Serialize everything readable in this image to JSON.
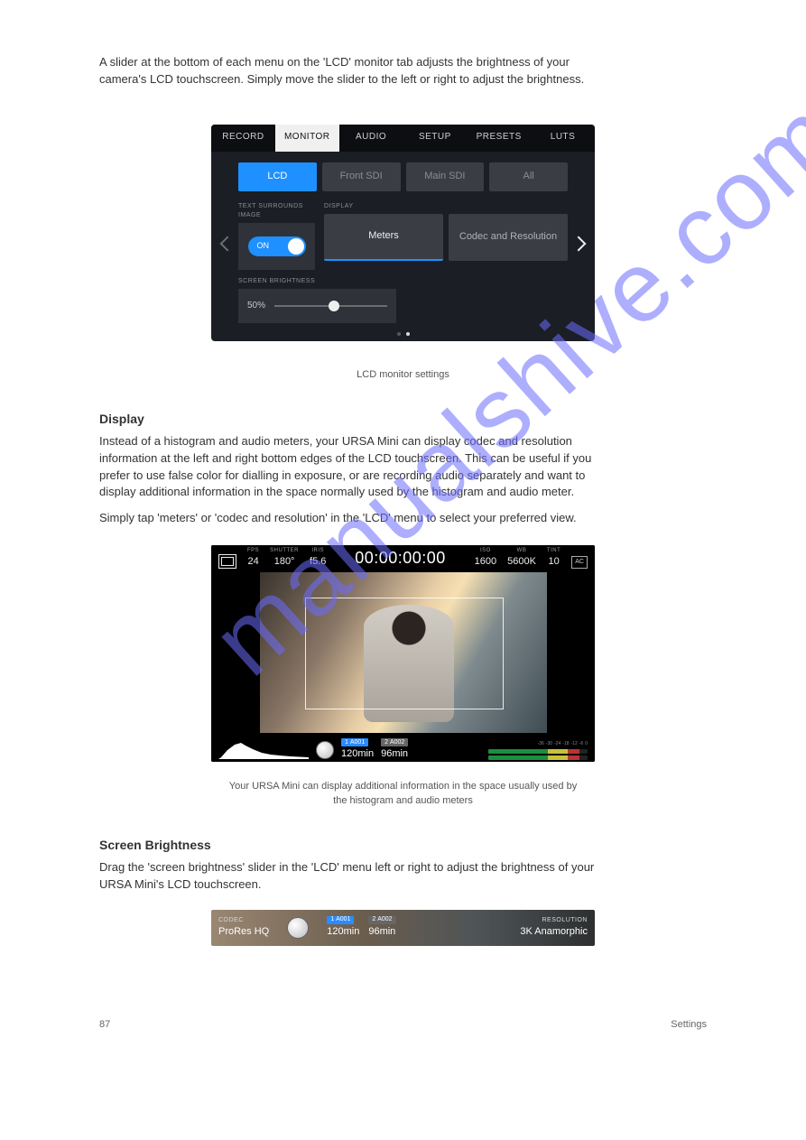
{
  "text": {
    "intro": "A slider at the bottom of each menu on the 'LCD' monitor tab adjusts the brightness of your camera's LCD touchscreen. Simply move the slider to the left or right to adjust the brightness.",
    "caption1": "LCD monitor settings",
    "display_heading": "Display",
    "display_para": "Instead of a histogram and audio meters, your URSA Mini can display codec and resolution information at the left and right bottom edges of the LCD touchscreen. This can be useful if you prefer to use false color for dialling in exposure, or are recording audio separately and want to display additional information in the space normally used by the histogram and audio meter.",
    "display_para2": "Simply tap 'meters' or 'codec and resolution' in the 'LCD' menu to select your preferred view.",
    "caption2": "Your URSA Mini can display additional information in the space usually used by the histogram and audio meters",
    "brightness_heading": "Screen Brightness",
    "brightness_para": "Drag the 'screen brightness' slider in the 'LCD' menu left or right to adjust the brightness of your URSA Mini's LCD touchscreen.",
    "footer_page": "87",
    "footer_section": "Settings"
  },
  "settings": {
    "tabs": [
      "RECORD",
      "MONITOR",
      "AUDIO",
      "SETUP",
      "PRESETS",
      "LUTS"
    ],
    "active_tab_index": 1,
    "subtabs": [
      "LCD",
      "Front SDI",
      "Main SDI",
      "All"
    ],
    "active_subtab_index": 0,
    "text_surrounds_label": "TEXT SURROUNDS IMAGE",
    "toggle": {
      "state": "ON"
    },
    "display_label": "DISPLAY",
    "display_options": [
      "Meters",
      "Codec and Resolution"
    ],
    "display_active_index": 0,
    "screen_brightness_label": "SCREEN BRIGHTNESS",
    "brightness_value": "50%"
  },
  "hud": {
    "fps": {
      "label": "FPS",
      "value": "24"
    },
    "shutter": {
      "label": "SHUTTER",
      "value": "180°"
    },
    "iris": {
      "label": "IRIS",
      "value": "f5.6"
    },
    "timecode": "00:00:00:00",
    "iso": {
      "label": "ISO",
      "value": "1600"
    },
    "wb": {
      "label": "WB",
      "value": "5600K"
    },
    "tint": {
      "label": "TINT",
      "value": "10"
    },
    "ac": "AC",
    "card1": {
      "num": "1",
      "name": "A001",
      "time": "120min"
    },
    "card2": {
      "num": "2",
      "name": "A002",
      "time": "96min"
    },
    "audio_scale": [
      "-36",
      "-30",
      "-24",
      "-18",
      "-12",
      "-6",
      "0"
    ]
  },
  "strip": {
    "codec": {
      "label": "CODEC",
      "value": "ProRes HQ"
    },
    "card1": {
      "num": "1",
      "name": "A001",
      "time": "120min"
    },
    "card2": {
      "num": "2",
      "name": "A002",
      "time": "96min"
    },
    "resolution": {
      "label": "RESOLUTION",
      "value": "3K Anamorphic"
    }
  },
  "watermark": "manualshive.com"
}
